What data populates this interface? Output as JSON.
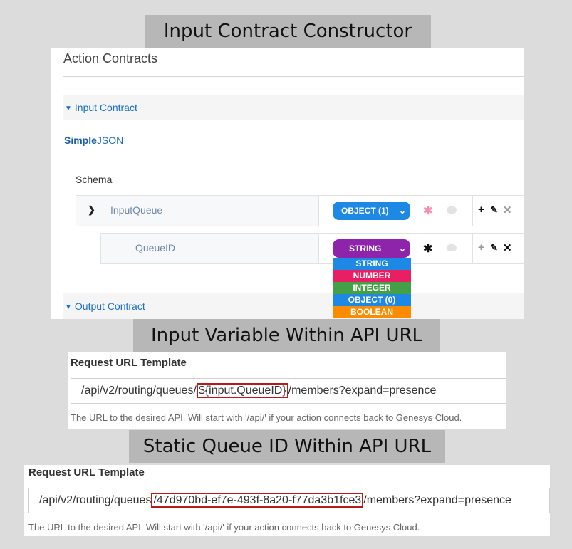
{
  "banners": {
    "b1": "Input Contract Constructor",
    "b2": "Input Variable Within API URL",
    "b3": "Static Queue ID Within API URL"
  },
  "panel1": {
    "title": "Action Contracts",
    "input_contract": "Input Contract",
    "output_contract": "Output Contract",
    "mode_simple": "Simple",
    "mode_json": "JSON",
    "schema_label": "Schema",
    "rows": [
      {
        "name": "InputQueue",
        "type": "OBJECT (1)",
        "required": "✱",
        "type_color": "#1e88e5"
      },
      {
        "name": "QueueID",
        "type": "STRING",
        "required": "✱",
        "type_color": "#8e24aa"
      }
    ],
    "actions": {
      "add": "+",
      "edit": "✎",
      "remove": "✕"
    },
    "type_options": [
      {
        "label": "STRING",
        "color": "#1e88e5"
      },
      {
        "label": "NUMBER",
        "color": "#e91e63"
      },
      {
        "label": "INTEGER",
        "color": "#43a047"
      },
      {
        "label": "OBJECT (0)",
        "color": "#1e88e5"
      },
      {
        "label": "BOOLEAN",
        "color": "#fb8c00"
      }
    ]
  },
  "panel2": {
    "label": "Request URL Template",
    "url_prefix": "/api/v2/routing/queues/",
    "url_highlight": "${input.QueueID}",
    "url_suffix": "/members?expand=presence",
    "help": "The URL to the desired API. Will start with '/api/' if your action connects back to Genesys Cloud."
  },
  "panel3": {
    "label": "Request URL Template",
    "url_prefix": "/api/v2/routing/queues",
    "url_highlight": "/47d970bd-ef7e-493f-8a20-f77da3b1fce3",
    "url_suffix": "/members?expand=presence",
    "help": "The URL to the desired API. Will start with '/api/' if your action connects back to Genesys Cloud."
  }
}
